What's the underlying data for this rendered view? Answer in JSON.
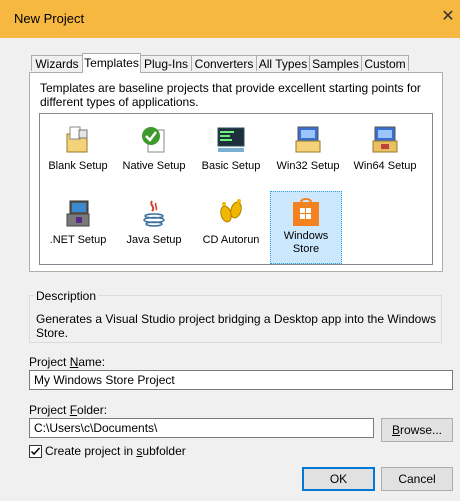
{
  "window": {
    "title": "New Project"
  },
  "tabs": [
    {
      "label": "Wizards"
    },
    {
      "label": "Templates"
    },
    {
      "label": "Plug-Ins"
    },
    {
      "label": "Converters"
    },
    {
      "label": "All Types"
    },
    {
      "label": "Samples"
    },
    {
      "label": "Custom"
    }
  ],
  "active_tab": "Templates",
  "templates_description": "Templates are baseline projects that provide excellent starting points for different types of applications.",
  "templates": [
    {
      "label": "Blank Setup",
      "icon": "blank-setup-icon"
    },
    {
      "label": "Native Setup",
      "icon": "native-setup-icon"
    },
    {
      "label": "Basic Setup",
      "icon": "basic-setup-icon"
    },
    {
      "label": "Win32 Setup",
      "icon": "win32-setup-icon"
    },
    {
      "label": "Win64 Setup",
      "icon": "win64-setup-icon"
    },
    {
      "label": ".NET Setup",
      "icon": "dotnet-setup-icon"
    },
    {
      "label": "Java Setup",
      "icon": "java-setup-icon"
    },
    {
      "label": "CD Autorun",
      "icon": "cd-autorun-icon"
    },
    {
      "label": "Windows Store",
      "icon": "windows-store-icon",
      "selected": true
    }
  ],
  "description": {
    "title": "Description",
    "text": "Generates a Visual Studio project bridging a Desktop app into the Windows Store."
  },
  "project_name": {
    "label_pre": "Project ",
    "label_key": "N",
    "label_post": "ame:",
    "value": "My Windows Store Project"
  },
  "project_folder": {
    "label_pre": "Project ",
    "label_key": "F",
    "label_post": "older:",
    "value": "C:\\Users\\c\\Documents\\"
  },
  "browse_button": {
    "label_key": "B",
    "label_post": "rowse..."
  },
  "subfolder_checkbox": {
    "checked": true,
    "label_pre": "Create project in ",
    "label_key": "s",
    "label_post": "ubfolder"
  },
  "ok_button": {
    "label": "OK"
  },
  "cancel_button": {
    "label": "Cancel"
  },
  "colors": {
    "titlebar": "#f6b840",
    "selection": "#cce8ff",
    "accent": "#0078d7"
  }
}
